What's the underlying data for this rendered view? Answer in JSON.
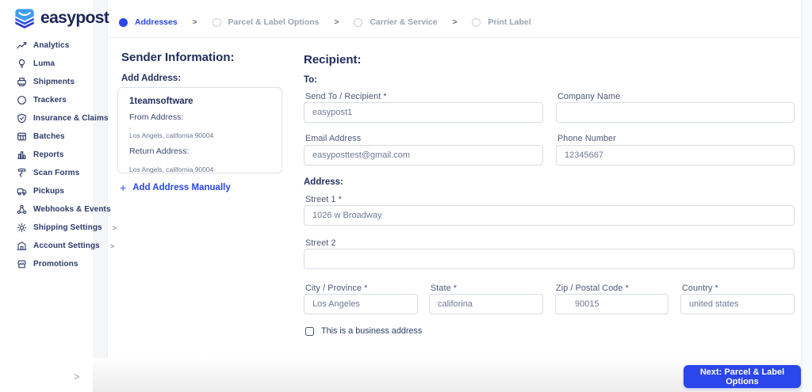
{
  "brand": {
    "name": "easypost"
  },
  "sidebar": {
    "items": [
      {
        "label": "Analytics"
      },
      {
        "label": "Luma"
      },
      {
        "label": "Shipments"
      },
      {
        "label": "Trackers"
      },
      {
        "label": "Insurance & Claims"
      },
      {
        "label": "Batches"
      },
      {
        "label": "Reports"
      },
      {
        "label": "Scan Forms"
      },
      {
        "label": "Pickups"
      },
      {
        "label": "Webhooks & Events"
      },
      {
        "label": "Shipping Settings"
      },
      {
        "label": "Account Settings"
      },
      {
        "label": "Promotions"
      }
    ],
    "submenu_chevron": ">",
    "collapse_chevron": ">"
  },
  "stepper": {
    "separator": ">",
    "steps": [
      {
        "label": "Addresses"
      },
      {
        "label": "Parcel & Label Options"
      },
      {
        "label": "Carrier & Service"
      },
      {
        "label": "Print Label"
      }
    ]
  },
  "sender": {
    "title": "Sender Information:",
    "add_address_label": "Add Address:",
    "card": {
      "name": "1teamsoftware",
      "from_label": "From Address:",
      "from_street": ",",
      "from_city": "Los Angels, california 90004",
      "return_label": "Return Address:",
      "return_city": "Los Angels, california 90004"
    },
    "plus_icon": "+",
    "add_manually_label": "Add Address Manually"
  },
  "recipient": {
    "title": "Recipient:",
    "to_label": "To:",
    "address_label": "Address:",
    "fields": {
      "send_to": {
        "label": "Send To / Recipient *",
        "value": "easypost1"
      },
      "company": {
        "label": "Company Name",
        "value": ""
      },
      "email": {
        "label": "Email Address",
        "value": "easyposttest@gmail.com"
      },
      "phone": {
        "label": "Phone Number",
        "value": "12345667"
      },
      "street1": {
        "label": "Street 1 *",
        "value": "1026 w Broadway"
      },
      "street2": {
        "label": "Street 2",
        "value": ""
      },
      "city": {
        "label": "City / Province *",
        "value": "Los Angeles"
      },
      "state": {
        "label": "State *",
        "value": "califorina"
      },
      "zip": {
        "label": "Zip / Postal Code *",
        "value": "90015"
      },
      "country": {
        "label": "Country *",
        "value": "united states"
      }
    },
    "business_checkbox_label": "This is a business address"
  },
  "footer": {
    "next_button": "Next: Parcel & Label Options"
  },
  "colors": {
    "accent": "#2b46ea",
    "navy": "#1f2c5a",
    "logo_light_blue": "#3f9df2",
    "logo_dark_blue": "#2438cf",
    "input_border": "#d7dce7",
    "muted_text": "#9aa3b4"
  }
}
